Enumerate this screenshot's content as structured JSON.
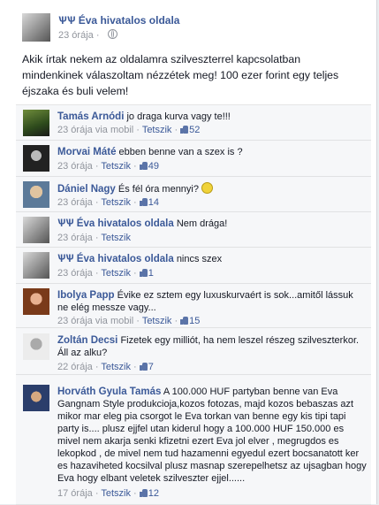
{
  "post": {
    "author": "ѰѰ Éva hivatalos oldala",
    "time": "23 órája",
    "text": "Akik írtak nekem az oldalamra szilveszterrel kapcsolatban mindenkinek válaszoltam nézzétek meg! 100 ezer forint egy teljes éjszaka és buli velem!"
  },
  "labels": {
    "via": "via mobil",
    "like": "Tetszik",
    "dot": "·"
  },
  "comments": [
    {
      "name": "Tamás Arnódi",
      "text": "jo draga kurva vagy te!!!",
      "time": "23 órája",
      "mobile": true,
      "likes": "52"
    },
    {
      "name": "Morvai Máté",
      "text": "ebben benne van a szex is ?",
      "time": "23 órája",
      "mobile": false,
      "likes": "49"
    },
    {
      "name": "Dániel Nagy",
      "text": "És fél óra mennyi?",
      "time": "23 órája",
      "mobile": false,
      "likes": "14"
    },
    {
      "name": "ѰѰ Éva hivatalos oldala",
      "text": "Nem drága!",
      "time": "23 órája",
      "mobile": false,
      "likes": ""
    },
    {
      "name": "ѰѰ Éva hivatalos oldala",
      "text": "nincs szex",
      "time": "23 órája",
      "mobile": false,
      "likes": "1"
    },
    {
      "name": "Ibolya Papp",
      "text": "Évike ez sztem egy luxuskurvaért is sok...amitől lássuk ne elég messze vagy...",
      "time": "23 órája",
      "mobile": true,
      "likes": "15"
    },
    {
      "name": "Zoltán Decsi",
      "text": "Fizetek egy milliót, ha nem leszel részeg szilveszterkor. Áll az alku?",
      "time": "22 órája",
      "mobile": false,
      "likes": "7"
    },
    {
      "name": "Horváth Gyula Tamás",
      "text": "A 100.000 HUF partyban benne van Eva Gangnam Style produkcioja,kozos fotozas, majd kozos bebaszas azt mikor mar eleg pia csorgot le Eva torkan van benne egy kis tipi tapi party is.... plusz ejjfel utan kiderul hogy a 100.000 HUF 150.000 es mivel nem akarja senki kfizetni ezert Eva jol elver , megrugdos es lekopkod , de mivel nem tud hazamenni egyedul ezert bocsanatott ker es hazaviheted kocsilval plusz masnap szerepelhetsz az ujsagban hogy Eva hogy elbant veletek szilveszter ejjel......",
      "time": "17 órája",
      "mobile": false,
      "likes": "12"
    }
  ]
}
